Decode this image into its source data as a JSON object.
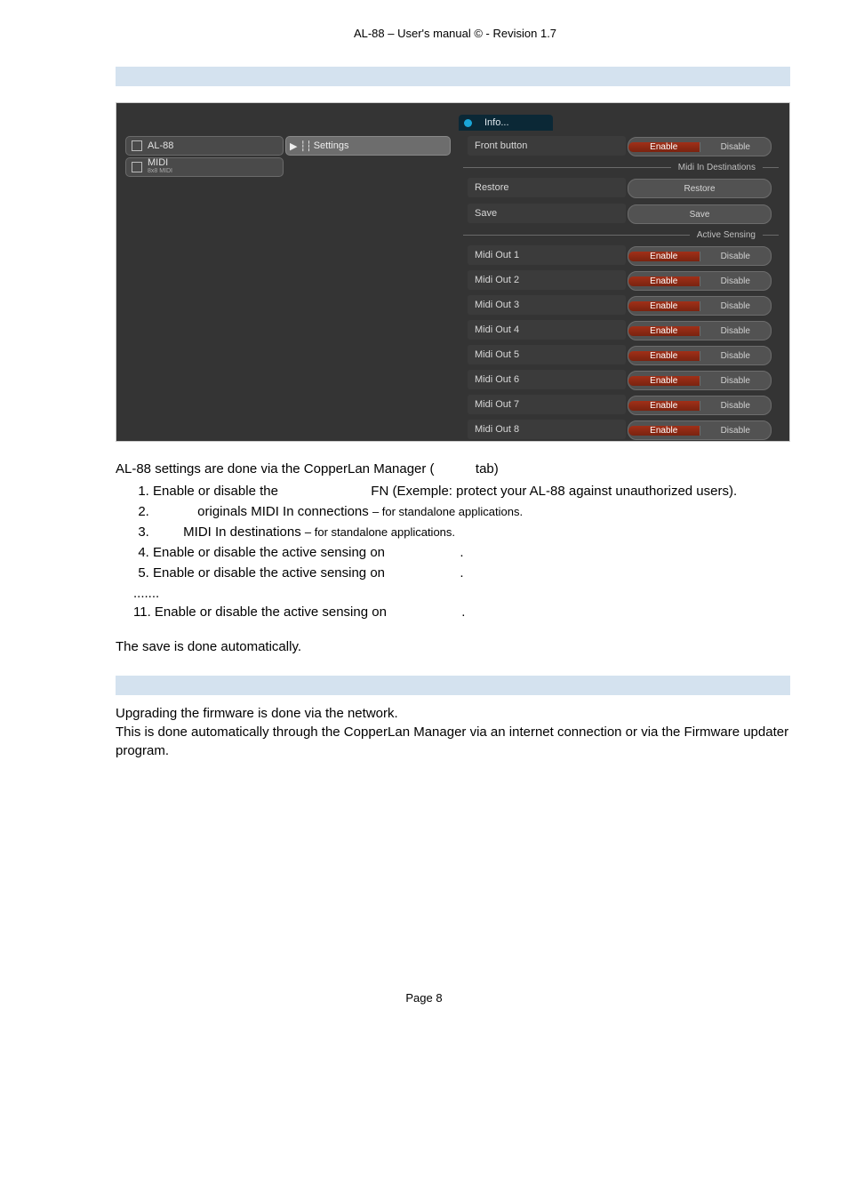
{
  "header": "AL-88 – User's manual ©  -  Revision 1.7",
  "footer": "Page 8",
  "shot": {
    "info_tab": "Info...",
    "tree_al88": "AL-88",
    "tree_midi_top": "MIDI",
    "tree_midi_sub": "8x8 MIDI",
    "settings_tab": "Settings",
    "row_front": "Front button",
    "row_restore": "Restore",
    "row_save": "Save",
    "grp_dest": "Midi In Destinations",
    "grp_active": "Active Sensing",
    "midi": [
      "Midi Out 1",
      "Midi Out 2",
      "Midi Out 3",
      "Midi Out 4",
      "Midi Out 5",
      "Midi Out 6",
      "Midi Out 7",
      "Midi Out 8"
    ],
    "enable": "Enable",
    "disable": "Disable",
    "restore_btn": "Restore",
    "save_btn": "Save"
  },
  "txt": {
    "p1a": "AL-88 settings are done via the CopperLan Manager (",
    "p1b": " tab)",
    "li1a": "Enable or disable the ",
    "li1b": " FN (Exemple:  protect your AL-88 against unauthorized users).",
    "li2a": " originals MIDI In connections ",
    "li2b": "– for standalone applications.",
    "li3a": " MIDI In destinations ",
    "li3b": "– for standalone applications.",
    "li4": "Enable or disable the active sensing on ",
    "li4dot": ".",
    "li5": "Enable or disable the active sensing on ",
    "li5dot": ".",
    "dots": ".......",
    "li11": "11. Enable or disable the active sensing on ",
    "li11dot": ".",
    "save_auto": "The save is done automatically.",
    "fw1": "Upgrading the firmware is done via the network.",
    "fw2": "This is done automatically through the CopperLan Manager via an internet connection or via the Firmware updater program."
  }
}
